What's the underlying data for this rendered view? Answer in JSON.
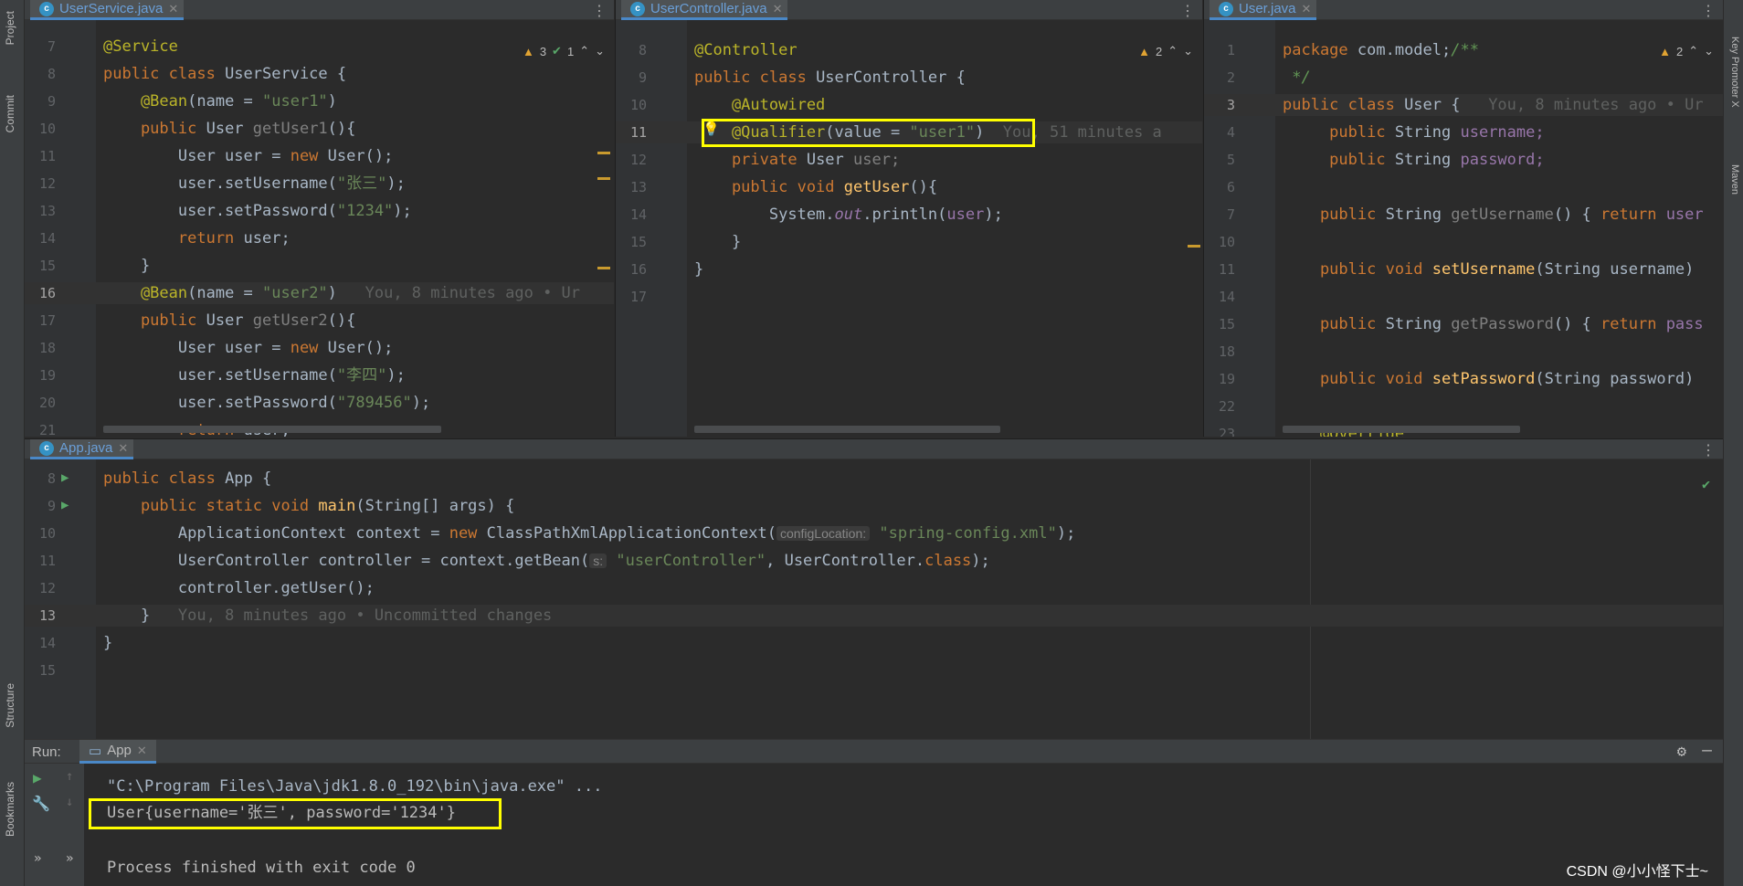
{
  "left_strip": {
    "project": "Project",
    "commit": "Commit",
    "structure": "Structure",
    "bookmarks": "Bookmarks"
  },
  "right_strip": {
    "key_promoter": "Key Promoter X",
    "maven": "Maven"
  },
  "pane1": {
    "tab": "UserService.java",
    "inspection": {
      "warnings": "3",
      "checks": "1"
    },
    "lines": [
      {
        "n": "7",
        "tokens": [
          {
            "t": "@Service",
            "c": "ann"
          }
        ]
      },
      {
        "n": "8",
        "tokens": [
          {
            "t": "public class ",
            "c": "kw"
          },
          {
            "t": "UserService {",
            "c": "fn"
          }
        ]
      },
      {
        "n": "9",
        "tokens": [
          {
            "t": "    @Bean",
            "c": "ann"
          },
          {
            "t": "(name = ",
            "c": "fn"
          },
          {
            "t": "\"user1\"",
            "c": "str"
          },
          {
            "t": ")",
            "c": "fn"
          }
        ]
      },
      {
        "n": "10",
        "tokens": [
          {
            "t": "    public ",
            "c": "kw"
          },
          {
            "t": "User ",
            "c": "fn"
          },
          {
            "t": "getUser1",
            "c": "gry"
          },
          {
            "t": "(){",
            "c": "fn"
          }
        ]
      },
      {
        "n": "11",
        "tokens": [
          {
            "t": "        User user = ",
            "c": "fn"
          },
          {
            "t": "new ",
            "c": "kw"
          },
          {
            "t": "User();",
            "c": "fn"
          }
        ]
      },
      {
        "n": "12",
        "tokens": [
          {
            "t": "        user.setUsername(",
            "c": "fn"
          },
          {
            "t": "\"张三\"",
            "c": "str"
          },
          {
            "t": ");",
            "c": "fn"
          }
        ]
      },
      {
        "n": "13",
        "tokens": [
          {
            "t": "        user.setPassword(",
            "c": "fn"
          },
          {
            "t": "\"1234\"",
            "c": "str"
          },
          {
            "t": ");",
            "c": "fn"
          }
        ]
      },
      {
        "n": "14",
        "tokens": [
          {
            "t": "        return ",
            "c": "kw"
          },
          {
            "t": "user;",
            "c": "fn"
          }
        ]
      },
      {
        "n": "15",
        "tokens": [
          {
            "t": "    }",
            "c": "fn"
          }
        ]
      },
      {
        "n": "16",
        "cur": true,
        "tokens": [
          {
            "t": "    @Bean",
            "c": "ann"
          },
          {
            "t": "(name = ",
            "c": "fn"
          },
          {
            "t": "\"user2\"",
            "c": "str"
          },
          {
            "t": ")   ",
            "c": "fn"
          },
          {
            "t": "You, 8 minutes ago • Ur",
            "c": "hint"
          }
        ]
      },
      {
        "n": "17",
        "tokens": [
          {
            "t": "    public ",
            "c": "kw"
          },
          {
            "t": "User ",
            "c": "fn"
          },
          {
            "t": "getUser2",
            "c": "gry"
          },
          {
            "t": "(){",
            "c": "fn"
          }
        ]
      },
      {
        "n": "18",
        "tokens": [
          {
            "t": "        User user = ",
            "c": "fn"
          },
          {
            "t": "new ",
            "c": "kw"
          },
          {
            "t": "User();",
            "c": "fn"
          }
        ]
      },
      {
        "n": "19",
        "tokens": [
          {
            "t": "        user.setUsername(",
            "c": "fn"
          },
          {
            "t": "\"李四\"",
            "c": "str"
          },
          {
            "t": ");",
            "c": "fn"
          }
        ]
      },
      {
        "n": "20",
        "tokens": [
          {
            "t": "        user.setPassword(",
            "c": "fn"
          },
          {
            "t": "\"789456\"",
            "c": "str"
          },
          {
            "t": ");",
            "c": "fn"
          }
        ]
      },
      {
        "n": "21",
        "tokens": [
          {
            "t": "        return ",
            "c": "kw"
          },
          {
            "t": "user;",
            "c": "fn"
          }
        ]
      }
    ]
  },
  "pane2": {
    "tab": "UserController.java",
    "inspection": {
      "warnings": "2"
    },
    "lines": [
      {
        "n": "8",
        "tokens": [
          {
            "t": "@Controller",
            "c": "ann"
          }
        ]
      },
      {
        "n": "9",
        "tokens": [
          {
            "t": "public class ",
            "c": "kw"
          },
          {
            "t": "UserController {",
            "c": "fn"
          }
        ]
      },
      {
        "n": "10",
        "tokens": [
          {
            "t": "    @Autowired",
            "c": "ann"
          }
        ]
      },
      {
        "n": "11",
        "cur": true,
        "tokens": [
          {
            "t": "    @Qualifier",
            "c": "ann"
          },
          {
            "t": "(value = ",
            "c": "fn"
          },
          {
            "t": "\"user1\"",
            "c": "str"
          },
          {
            "t": ")  ",
            "c": "fn"
          },
          {
            "t": "You, 51 minutes a",
            "c": "hint"
          }
        ]
      },
      {
        "n": "12",
        "tokens": [
          {
            "t": "    private ",
            "c": "kw"
          },
          {
            "t": "User ",
            "c": "fn"
          },
          {
            "t": "user;",
            "c": "gry"
          }
        ]
      },
      {
        "n": "13",
        "tokens": [
          {
            "t": "    public void ",
            "c": "kw"
          },
          {
            "t": "getUser",
            "c": "mth"
          },
          {
            "t": "(){",
            "c": "fn"
          }
        ]
      },
      {
        "n": "14",
        "tokens": [
          {
            "t": "        System.",
            "c": "fn"
          },
          {
            "t": "out",
            "c": "it"
          },
          {
            "t": ".println(",
            "c": "fn"
          },
          {
            "t": "user",
            "c": "fld"
          },
          {
            "t": ");",
            "c": "fn"
          }
        ]
      },
      {
        "n": "15",
        "tokens": [
          {
            "t": "    }",
            "c": "fn"
          }
        ]
      },
      {
        "n": "16",
        "tokens": [
          {
            "t": "}",
            "c": "fn"
          }
        ]
      },
      {
        "n": "17",
        "tokens": []
      }
    ]
  },
  "pane3": {
    "tab": "User.java",
    "inspection": {
      "warnings": "2"
    },
    "lines": [
      {
        "n": "1",
        "tokens": [
          {
            "t": "package ",
            "c": "kw"
          },
          {
            "t": "com.model;",
            "c": "fn"
          },
          {
            "t": "/**",
            "c": "cmt"
          }
        ]
      },
      {
        "n": "2",
        "tokens": [
          {
            "t": " */",
            "c": "cmt"
          }
        ]
      },
      {
        "n": "3",
        "cur": true,
        "tokens": [
          {
            "t": "public class ",
            "c": "kw"
          },
          {
            "t": "User {   ",
            "c": "fn"
          },
          {
            "t": "You, 8 minutes ago • Ur",
            "c": "hint"
          }
        ]
      },
      {
        "n": "4",
        "tokens": [
          {
            "t": "     public ",
            "c": "kw"
          },
          {
            "t": "String ",
            "c": "fn"
          },
          {
            "t": "username;",
            "c": "fld"
          }
        ]
      },
      {
        "n": "5",
        "tokens": [
          {
            "t": "     public ",
            "c": "kw"
          },
          {
            "t": "String ",
            "c": "fn"
          },
          {
            "t": "password;",
            "c": "fld"
          }
        ]
      },
      {
        "n": "6",
        "tokens": []
      },
      {
        "n": "7",
        "tokens": [
          {
            "t": "    public ",
            "c": "kw"
          },
          {
            "t": "String ",
            "c": "fn"
          },
          {
            "t": "getUsername",
            "c": "gry"
          },
          {
            "t": "() { ",
            "c": "fn"
          },
          {
            "t": "return ",
            "c": "kw"
          },
          {
            "t": "user",
            "c": "fld"
          }
        ]
      },
      {
        "n": "10",
        "tokens": []
      },
      {
        "n": "11",
        "tokens": [
          {
            "t": "    public void ",
            "c": "kw"
          },
          {
            "t": "setUsername",
            "c": "mth"
          },
          {
            "t": "(String username)",
            "c": "fn"
          }
        ]
      },
      {
        "n": "14",
        "tokens": []
      },
      {
        "n": "15",
        "tokens": [
          {
            "t": "    public ",
            "c": "kw"
          },
          {
            "t": "String ",
            "c": "fn"
          },
          {
            "t": "getPassword",
            "c": "gry"
          },
          {
            "t": "() { ",
            "c": "fn"
          },
          {
            "t": "return ",
            "c": "kw"
          },
          {
            "t": "pass",
            "c": "fld"
          }
        ]
      },
      {
        "n": "18",
        "tokens": []
      },
      {
        "n": "19",
        "tokens": [
          {
            "t": "    public void ",
            "c": "kw"
          },
          {
            "t": "setPassword",
            "c": "mth"
          },
          {
            "t": "(String password)",
            "c": "fn"
          }
        ]
      },
      {
        "n": "22",
        "tokens": []
      },
      {
        "n": "23",
        "tokens": [
          {
            "t": "    @Override",
            "c": "ann"
          }
        ]
      }
    ]
  },
  "pane4": {
    "tab": "App.java",
    "lines": [
      {
        "n": "8",
        "run": true,
        "tokens": [
          {
            "t": "public class ",
            "c": "kw"
          },
          {
            "t": "App {",
            "c": "fn"
          }
        ]
      },
      {
        "n": "9",
        "run": true,
        "tokens": [
          {
            "t": "    public static void ",
            "c": "kw"
          },
          {
            "t": "main",
            "c": "mth"
          },
          {
            "t": "(String[] args) {",
            "c": "fn"
          }
        ]
      },
      {
        "n": "10",
        "tokens": [
          {
            "t": "        ApplicationContext context = ",
            "c": "fn"
          },
          {
            "t": "new ",
            "c": "kw"
          },
          {
            "t": "ClassPathXmlApplicationContext(",
            "c": "fn"
          },
          {
            "t": "configLocation:",
            "c": "inlay"
          },
          {
            "t": " \"spring-config.xml\"",
            "c": "str"
          },
          {
            "t": ");",
            "c": "fn"
          }
        ]
      },
      {
        "n": "11",
        "tokens": [
          {
            "t": "        UserController controller = context.getBean(",
            "c": "fn"
          },
          {
            "t": "s:",
            "c": "inlay"
          },
          {
            "t": " \"userController\"",
            "c": "str"
          },
          {
            "t": ", UserController.",
            "c": "fn"
          },
          {
            "t": "class",
            "c": "kw"
          },
          {
            "t": ");",
            "c": "fn"
          }
        ]
      },
      {
        "n": "12",
        "tokens": [
          {
            "t": "        controller.getUser();",
            "c": "fn"
          }
        ]
      },
      {
        "n": "13",
        "cur": true,
        "tokens": [
          {
            "t": "    }   ",
            "c": "fn"
          },
          {
            "t": "You, 8 minutes ago • Uncommitted changes",
            "c": "hint"
          }
        ]
      },
      {
        "n": "14",
        "tokens": [
          {
            "t": "}",
            "c": "fn"
          }
        ]
      },
      {
        "n": "15",
        "tokens": []
      }
    ]
  },
  "run": {
    "label": "Run:",
    "tab": "App",
    "command": "\"C:\\Program Files\\Java\\jdk1.8.0_192\\bin\\java.exe\" ...",
    "output": "User{username='张三', password='1234'}",
    "exit": "Process finished with exit code 0"
  },
  "watermark": "CSDN @小小怪下士~"
}
